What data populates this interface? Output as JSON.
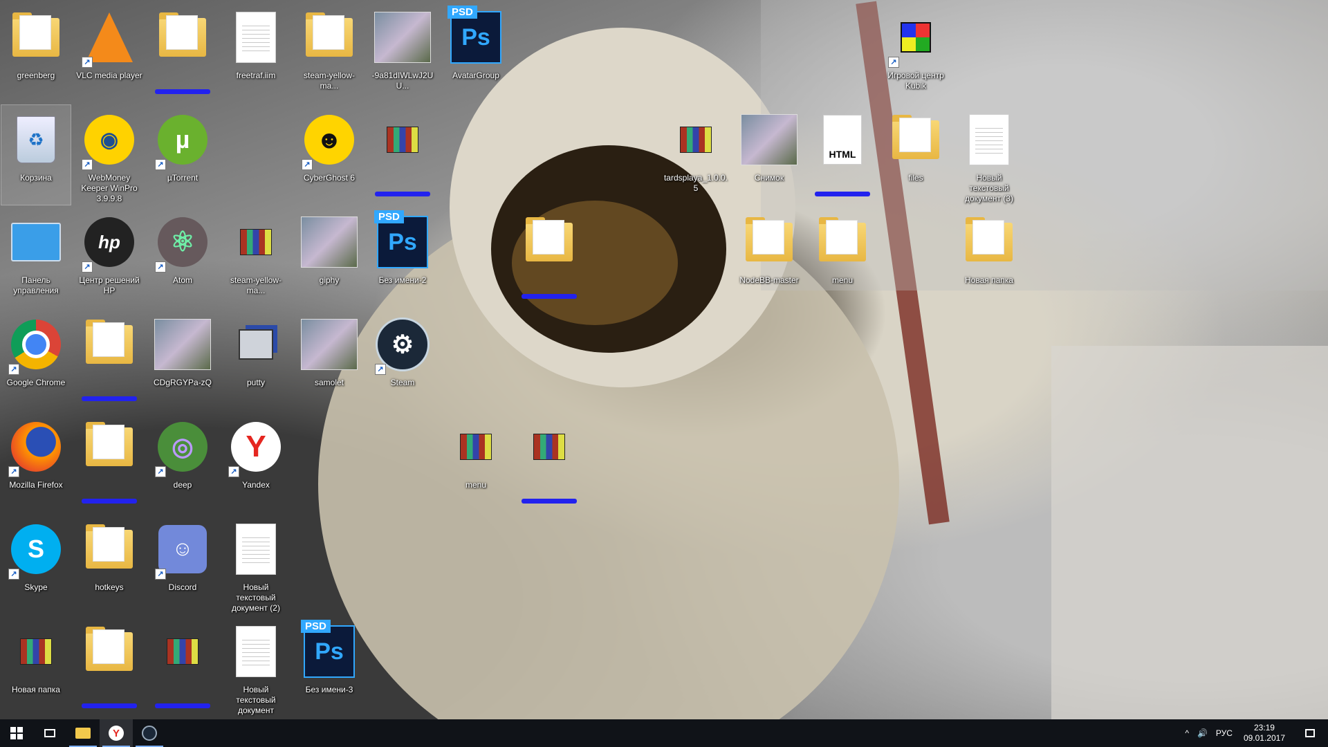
{
  "desktop": {
    "icons": [
      {
        "label": "greenberg",
        "icon": "user-folder-icon"
      },
      {
        "label": "VLC media player",
        "icon": "vlc-icon"
      },
      {
        "label": "",
        "icon": "folder-icon",
        "redacted": true
      },
      {
        "label": "freetraf.iim",
        "icon": "document-icon"
      },
      {
        "label": "steam-yellow-ma...",
        "icon": "folder-icon"
      },
      {
        "label": "-9a81dIWLwJ2UU...",
        "icon": "image-icon"
      },
      {
        "label": "AvatarGroup",
        "icon": "photoshop-icon"
      },
      {
        "label": "Игровой центр Kubik",
        "icon": "rubiks-cube-icon"
      },
      {
        "label": "Корзина",
        "icon": "recycle-bin-icon"
      },
      {
        "label": "WebMoney Keeper WinPro 3.9.9.8",
        "icon": "webmoney-icon"
      },
      {
        "label": "µTorrent",
        "icon": "utorrent-icon"
      },
      {
        "label": "CyberGhost 6",
        "icon": "cyberghost-icon"
      },
      {
        "label": "",
        "icon": "winrar-archive-icon",
        "redacted": true
      },
      {
        "label": "tardsplaya_1.0.0.5",
        "icon": "winrar-archive-icon"
      },
      {
        "label": "Снимок",
        "icon": "image-icon"
      },
      {
        "label": "",
        "icon": "html-file-icon",
        "redacted": true
      },
      {
        "label": "files",
        "icon": "folder-icon"
      },
      {
        "label": "Новый текстовый документ (3)",
        "icon": "text-document-icon"
      },
      {
        "label": "Панель управления",
        "icon": "control-panel-icon"
      },
      {
        "label": "Центр решений HP",
        "icon": "hp-icon"
      },
      {
        "label": "Atom",
        "icon": "atom-icon"
      },
      {
        "label": "steam-yellow-ma...",
        "icon": "winrar-archive-icon"
      },
      {
        "label": "giphy",
        "icon": "image-icon"
      },
      {
        "label": "Без имени-2",
        "icon": "photoshop-icon"
      },
      {
        "label": "",
        "icon": "folder-icon",
        "redacted": true
      },
      {
        "label": "NodeBB-master",
        "icon": "folder-icon"
      },
      {
        "label": "menu",
        "icon": "folder-icon"
      },
      {
        "label": "Новая папка",
        "icon": "folder-icon"
      },
      {
        "label": "Google Chrome",
        "icon": "chrome-icon"
      },
      {
        "label": "",
        "icon": "folder-icon",
        "redacted": true
      },
      {
        "label": "CDgRGYPa-zQ",
        "icon": "image-icon"
      },
      {
        "label": "putty",
        "icon": "putty-icon"
      },
      {
        "label": "samolet",
        "icon": "image-icon"
      },
      {
        "label": "Steam",
        "icon": "steam-icon"
      },
      {
        "label": "Mozilla Firefox",
        "icon": "firefox-icon"
      },
      {
        "label": "",
        "icon": "folder-icon",
        "redacted": true
      },
      {
        "label": "deep",
        "icon": "deep-icon"
      },
      {
        "label": "Yandex",
        "icon": "yandex-icon"
      },
      {
        "label": "menu",
        "icon": "winrar-archive-icon"
      },
      {
        "label": "",
        "icon": "winrar-archive-icon",
        "redacted": true
      },
      {
        "label": "Skype",
        "icon": "skype-icon"
      },
      {
        "label": "hotkeys",
        "icon": "folder-icon"
      },
      {
        "label": "Discord",
        "icon": "discord-icon"
      },
      {
        "label": "Новый текстовый документ (2)",
        "icon": "text-document-icon"
      },
      {
        "label": "Новая папка",
        "icon": "winrar-archive-icon"
      },
      {
        "label": "",
        "icon": "folder-icon",
        "redacted": true
      },
      {
        "label": "",
        "icon": "winrar-archive-icon",
        "redacted": true
      },
      {
        "label": "Новый текстовый документ",
        "icon": "text-document-icon"
      },
      {
        "label": "Без имени-3",
        "icon": "photoshop-icon"
      }
    ]
  },
  "taskbar": {
    "start": "start-icon",
    "task_view": "task-view-icon",
    "pinned": [
      "file-explorer-icon",
      "yandex-browser-icon",
      "steam-icon"
    ],
    "tray": {
      "chevron": "^",
      "volume": "🔊",
      "language": "РУС",
      "time": "23:19",
      "date": "09.01.2017"
    }
  },
  "colors": {
    "taskbar": "#101318",
    "accent": "#7fb2ff",
    "label": "#ffffff"
  }
}
